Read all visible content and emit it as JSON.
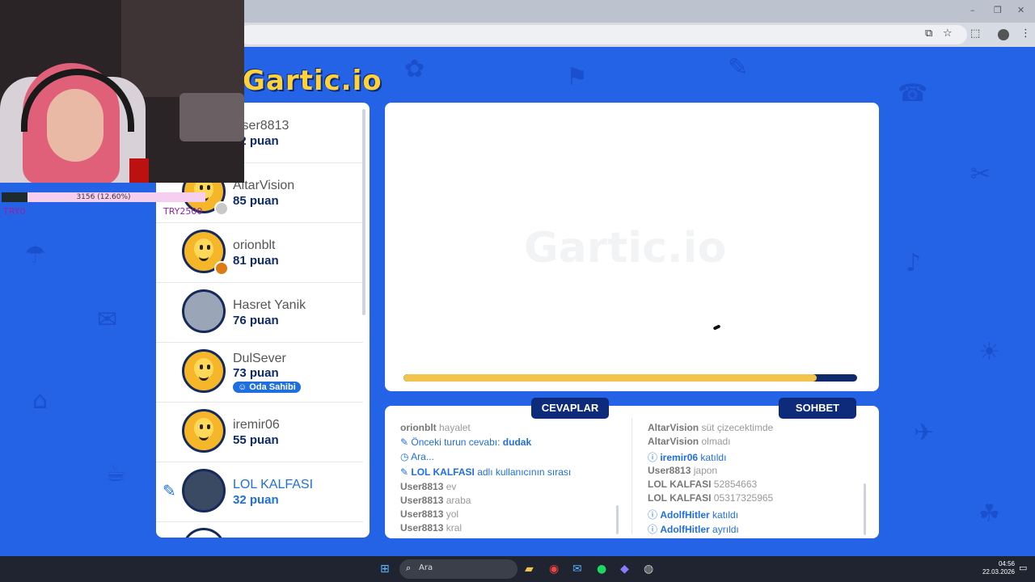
{
  "browser": {
    "window_controls": [
      "–",
      "❐",
      "✕"
    ],
    "toolbar_icons": [
      "⧉",
      "☆",
      "⬚",
      "⋮"
    ]
  },
  "site": {
    "logo": "Gartic.io",
    "watermark": "Gartic.io"
  },
  "players": [
    {
      "name": "User8813",
      "score": "12 puan"
    },
    {
      "name": "AltarVision",
      "score": "85 puan"
    },
    {
      "name": "orionblt",
      "score": "81 puan"
    },
    {
      "name": "Hasret Yanik",
      "score": "76 puan"
    },
    {
      "name": "DulSever",
      "score": "73 puan",
      "badge": "Oda Sahibi"
    },
    {
      "name": "iremir06",
      "score": "55 puan"
    },
    {
      "name": "LOL KALFASI",
      "score": "32 puan"
    }
  ],
  "timer": {
    "progress": 0.91
  },
  "tabs": {
    "answers": "CEVAPLAR",
    "chat": "SOHBET"
  },
  "answers": [
    {
      "user": "orionblt",
      "text": "hayalet"
    },
    {
      "prefix": "Önceki turun cevabı:",
      "value": "dudak"
    },
    {
      "text": "Ara..."
    },
    {
      "user": "LOL KALFASI",
      "text": "adlı kullanıcının sırası"
    },
    {
      "user": "User8813",
      "text": "ev"
    },
    {
      "user": "User8813",
      "text": "araba"
    },
    {
      "user": "User8813",
      "text": "yol"
    },
    {
      "user": "User8813",
      "text": "kral"
    }
  ],
  "chat": [
    {
      "user": "AltarVision",
      "text": "süt çizecektimde"
    },
    {
      "user": "AltarVision",
      "text": "olmadı"
    },
    {
      "user": "iremir06",
      "text": "katıldı"
    },
    {
      "user": "User8813",
      "text": "japon"
    },
    {
      "user": "LOL KALFASI",
      "text": "52854663"
    },
    {
      "user": "LOL KALFASI",
      "text": "05317325965"
    },
    {
      "user": "AdolfHitler",
      "text": "katıldı"
    },
    {
      "user": "AdolfHitler",
      "text": "ayrıldı"
    }
  ],
  "overlay": {
    "xp_text": "3156 (12.60%)",
    "xp_fraction": 0.126,
    "try_left": "TRY0",
    "try_right": "TRY2500"
  },
  "taskbar": {
    "search_placeholder": "Ara",
    "time": "04:56",
    "date": "22.03.2026"
  },
  "colors": {
    "background": "#2463e6",
    "accent": "#1f6fe0",
    "dark_navy": "#0e2a7a",
    "timer": "#f2c44b"
  }
}
